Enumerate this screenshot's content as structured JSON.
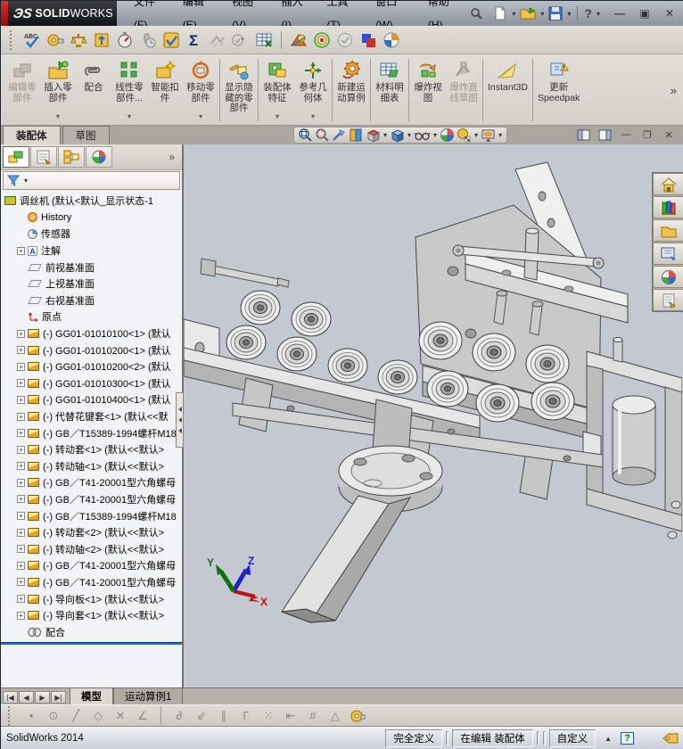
{
  "titlebar": {
    "logo_mark": "ЭS",
    "brand_bold": "SOLID",
    "brand_light": "WORKS",
    "menus": [
      "文件(F)",
      "编辑(E)",
      "视图(V)",
      "插入(I)",
      "工具(T)",
      "窗口(W)",
      "帮助(H)"
    ]
  },
  "toolbar2": {
    "icons": [
      "spell-check",
      "measure",
      "mass-properties",
      "coordinate-system",
      "performance-evaluation",
      "pin-clock",
      "selection-filter",
      "equations",
      "deviation-analysis",
      "check-dropdown",
      "design-table",
      "render-preview",
      "lights",
      "verification",
      "compare-documents",
      "edrawings"
    ]
  },
  "ribbon": {
    "overflow": "»",
    "buttons": [
      {
        "label": "编辑零\n部件",
        "icon": "edit-component",
        "disabled": true
      },
      {
        "label": "插入零\n部件",
        "icon": "insert-component",
        "dropdown": true
      },
      {
        "label": "配合",
        "icon": "mate"
      },
      {
        "label": "线性零\n部件...",
        "icon": "linear-component-pattern",
        "dropdown": true
      },
      {
        "label": "智能扣\n件",
        "icon": "smart-fasteners"
      },
      {
        "label": "移动零\n部件",
        "icon": "move-component",
        "dropdown": true
      },
      {
        "label": "显示隐\n藏的零\n部件",
        "icon": "show-hidden-components"
      },
      {
        "label": "装配体\n特征",
        "icon": "assembly-features",
        "dropdown": true
      },
      {
        "label": "参考几\n何体",
        "icon": "reference-geometry",
        "dropdown": true
      },
      {
        "label": "新建运\n动算例",
        "icon": "new-motion-study"
      },
      {
        "label": "材料明\n细表",
        "icon": "bill-of-materials"
      },
      {
        "label": "爆炸视\n图",
        "icon": "exploded-view"
      },
      {
        "label": "爆炸直\n线草图",
        "icon": "explode-line-sketch",
        "disabled": true
      },
      {
        "label": "Instant3D",
        "icon": "instant3d"
      },
      {
        "label": "更新\nSpeedpak",
        "icon": "update-speedpak"
      }
    ]
  },
  "command_tabs": {
    "tabs": [
      {
        "label": "装配体",
        "active": true
      },
      {
        "label": "草图",
        "active": false
      }
    ]
  },
  "headsup": {
    "icons": [
      "zoom-fit",
      "zoom-area",
      "previous-view",
      "section-view",
      "view-orientation",
      "display-style",
      "hide-show-items",
      "edit-appearance",
      "apply-scene",
      "view-settings"
    ],
    "window_icons": [
      "pane-left",
      "pane-right",
      "minimize",
      "restore",
      "close"
    ]
  },
  "panel": {
    "header_tabs": [
      "featuremanager-tree",
      "propertymanager",
      "configurationmanager",
      "displaymanager"
    ],
    "overflow": "»",
    "tree": {
      "expander": "+",
      "root": {
        "label": "调丝机  (默认<默认_显示状态-1"
      },
      "items": [
        {
          "icon": "history",
          "label": "History"
        },
        {
          "icon": "sensors",
          "label": "传感器"
        },
        {
          "icon": "annotations",
          "label": "注解",
          "expand": true
        },
        {
          "icon": "plane",
          "label": "前视基准面"
        },
        {
          "icon": "plane",
          "label": "上视基准面"
        },
        {
          "icon": "plane",
          "label": "右视基准面"
        },
        {
          "icon": "origin",
          "label": "原点"
        },
        {
          "icon": "part",
          "label": "(-) GG01-01010100<1> (默认",
          "expand": true
        },
        {
          "icon": "part",
          "label": "(-) GG01-01010200<1> (默认",
          "expand": true
        },
        {
          "icon": "part",
          "label": "(-) GG01-01010200<2> (默认",
          "expand": true
        },
        {
          "icon": "part",
          "label": "(-) GG01-01010300<1> (默认",
          "expand": true
        },
        {
          "icon": "part",
          "label": "(-) GG01-01010400<1> (默认",
          "expand": true
        },
        {
          "icon": "part",
          "label": "(-) 代替花键套<1> (默认<<默",
          "expand": true
        },
        {
          "icon": "part",
          "label": "(-) GB／T15389-1994螺杆M18",
          "expand": true
        },
        {
          "icon": "part",
          "label": "(-) 转动套<1> (默认<<默认>",
          "expand": true
        },
        {
          "icon": "part",
          "label": "(-) 转动轴<1> (默认<<默认>",
          "expand": true
        },
        {
          "icon": "part",
          "label": "(-) GB／T41-20001型六角螺母",
          "expand": true
        },
        {
          "icon": "part",
          "label": "(-) GB／T41-20001型六角螺母",
          "expand": true
        },
        {
          "icon": "part",
          "label": "(-) GB／T15389-1994螺杆M18",
          "expand": true
        },
        {
          "icon": "part",
          "label": "(-) 转动套<2> (默认<<默认>",
          "expand": true
        },
        {
          "icon": "part",
          "label": "(-) 转动轴<2> (默认<<默认>",
          "expand": true
        },
        {
          "icon": "part",
          "label": "(-) GB／T41-20001型六角螺母",
          "expand": true
        },
        {
          "icon": "part",
          "label": "(-) GB／T41-20001型六角螺母",
          "expand": true
        },
        {
          "icon": "part",
          "label": "(-) 导向板<1> (默认<<默认>",
          "expand": true
        },
        {
          "icon": "part",
          "label": "(-) 导向套<1> (默认<<默认>",
          "expand": true
        },
        {
          "icon": "mates",
          "label": "配合"
        }
      ]
    }
  },
  "taskpane": {
    "tabs": [
      "home",
      "design-library",
      "file-explorer",
      "view-palette",
      "appearances",
      "custom-properties"
    ]
  },
  "viewport": {
    "triad": {
      "x": "X",
      "y": "Y",
      "z": "Z"
    }
  },
  "bottom_tabs": {
    "tabs": [
      {
        "label": "模型",
        "active": true
      },
      {
        "label": "运动算例1",
        "active": false
      }
    ]
  },
  "statusbar": {
    "app": "SolidWorks 2014",
    "define_state": "完全定义",
    "edit_state": "在编辑 装配体",
    "units": "自定义",
    "help": "?"
  }
}
